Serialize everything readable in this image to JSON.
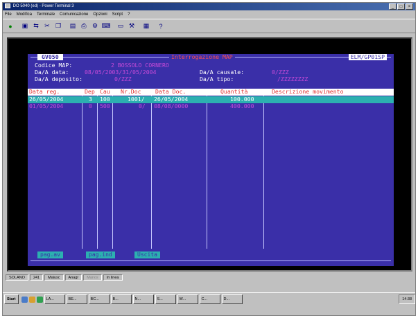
{
  "window": {
    "title": "DO 5040 (ed) - Power Terminal 3"
  },
  "menu": [
    "File",
    "Modifica",
    "Terminale",
    "Comunicazione",
    "Opzioni",
    "Script",
    "?"
  ],
  "toolbar": [
    "new-icon",
    "save-icon",
    "connect-icon",
    "cut-icon",
    "copy-icon",
    "paste-icon",
    "print-icon",
    "settings-icon",
    "keyboard-icon",
    "window-icon",
    "tools-icon",
    "grid-icon",
    "help-icon"
  ],
  "terminal": {
    "code": "GV050",
    "title": "Interrogazione MAP",
    "id": "ELM/GP01SP",
    "fields": {
      "codice_label": "Codice MAP:",
      "codice_value": "2 BOSSOLO CORNERO",
      "da_data_label": "Da/A data:",
      "da_data_value": "08/05/2003/31/05/2004",
      "causale_label": "Da/A causale:",
      "causale_value": "0/ZZZ",
      "deposito_label": "Da/A deposito:",
      "deposito_value": "0/ZZZ",
      "tipo_label": "Da/A tipo:",
      "tipo_value": "/ZZZZZZZZ"
    },
    "table": {
      "headers": [
        "Data reg.",
        "Dep",
        "Cau",
        "Nr.Doc",
        "Data Doc.",
        "Quantità",
        "Descrizione movimento"
      ],
      "rows": [
        [
          "26/05/2004",
          "3",
          "100",
          "1001/",
          "26/05/2004",
          "100.000",
          ""
        ],
        [
          "01/05/2004",
          "0",
          "500",
          "0/",
          "08/08/0000",
          "400.000",
          ""
        ]
      ]
    },
    "fkeys": [
      "pag.av",
      "pag.ind",
      "Uscita"
    ]
  },
  "status": [
    "SOLANO",
    "241",
    "Maiusc",
    "Anagr",
    "Manos",
    "In linea"
  ],
  "taskbar": {
    "start": "Start",
    "tasks": [
      "LA...",
      "BE...",
      "BC...",
      "B...",
      "N...",
      "S...",
      "W...",
      "C...",
      "D..."
    ],
    "time": "14:38"
  }
}
